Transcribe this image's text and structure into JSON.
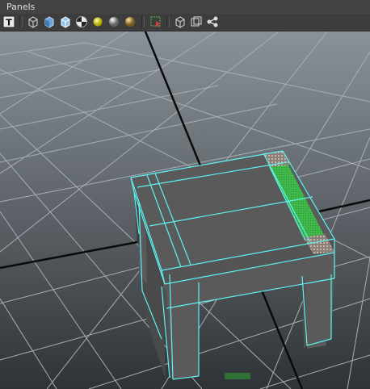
{
  "menu": {
    "items": [
      "Panels"
    ]
  },
  "toolbar": {
    "text_label": "T",
    "tools": [
      {
        "name": "wireframe-cube-icon"
      },
      {
        "name": "smooth-shade-cube-icon"
      },
      {
        "name": "wireframe-on-shaded-cube-icon"
      },
      {
        "name": "checker-texture-icon"
      },
      {
        "name": "default-light-icon"
      },
      {
        "name": "shadow-sphere-icon"
      },
      {
        "name": "ambient-occlusion-sphere-icon"
      },
      {
        "name": "isolate-select-icon"
      },
      {
        "name": "xray-cube-icon"
      },
      {
        "name": "two-panel-icon"
      },
      {
        "name": "node-graph-icon"
      }
    ]
  },
  "viewport": {
    "background_top": "#8a9299",
    "background_bottom": "#2f3336",
    "grid_color": "#a7aeb4",
    "wire_color": "#5ef2f2",
    "face_color": "#5a5a5a",
    "selected_face_color": "#3fb94a",
    "camera_label": ""
  }
}
